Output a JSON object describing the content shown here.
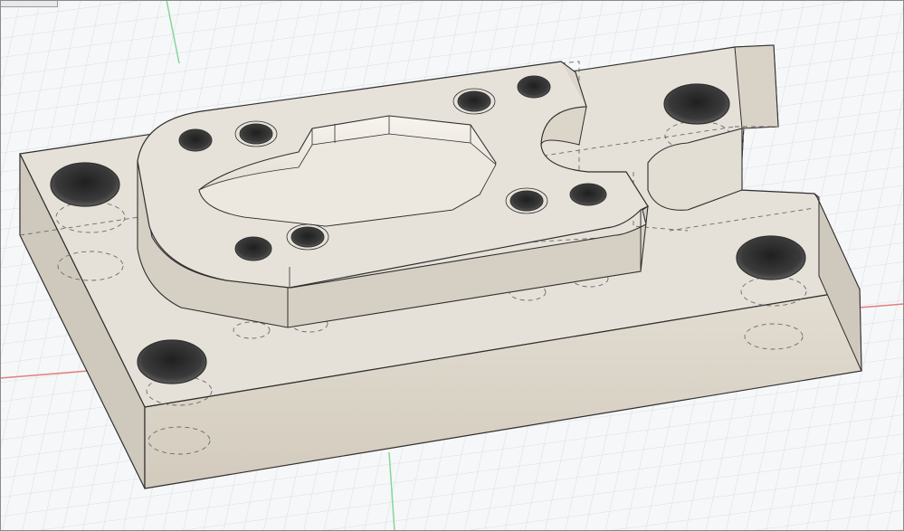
{
  "viewport": {
    "background": "#f6f7f8",
    "grid_color": "#d9dde2",
    "axis_x_color": "#e26a6a",
    "axis_y_color": "#6fd28a",
    "body_top_color": "#e6e1d8",
    "body_front_color": "#d8d2c7",
    "body_side_color": "#cfc9bd",
    "edge_color": "#2f2f2f",
    "hidden_edge_color": "#6b6b6b",
    "hole_color": "#3a3a3a"
  },
  "corner_tab": {
    "icon": "panel-handle-icon"
  }
}
